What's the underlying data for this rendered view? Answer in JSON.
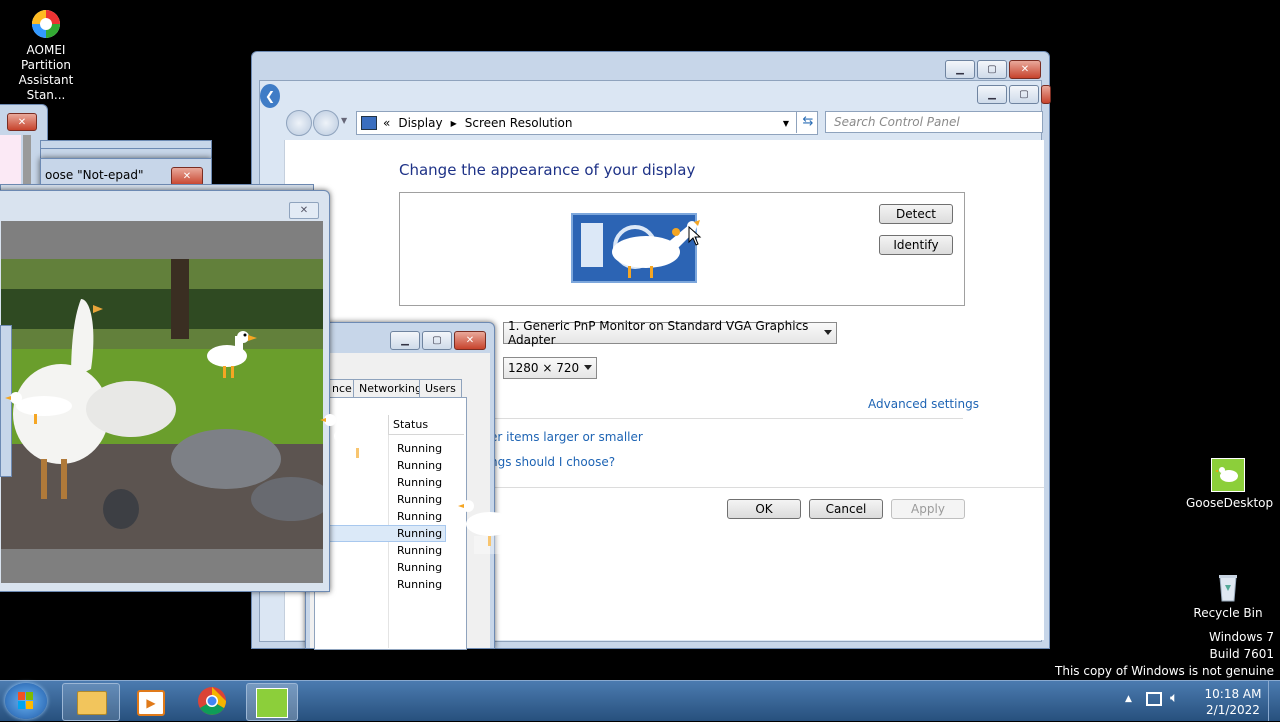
{
  "desktop": {
    "icons": [
      {
        "label_line1": "AOMEI Partition",
        "label_line2": "Assistant Stan..."
      },
      {
        "label": "GooseDesktop"
      },
      {
        "label": "Recycle Bin"
      }
    ],
    "watermark": {
      "line1": "Windows 7",
      "line2": "Build 7601",
      "line3": "This copy of Windows is not genuine"
    }
  },
  "control_panel": {
    "breadcrumb": {
      "prefix": "«",
      "item1": "Display",
      "item2": "Screen Resolution"
    },
    "search_placeholder": "Search Control Panel",
    "heading": "Change the appearance of your display",
    "detect_label": "Detect",
    "identify_label": "Identify",
    "display_select": "1. Generic PnP Monitor on Standard VGA Graphics Adapter",
    "resolution_select": "1280 × 720",
    "advanced_settings": "Advanced settings",
    "link_larger": "er items larger or smaller",
    "link_choose": "ngs should I choose?",
    "ok_label": "OK",
    "cancel_label": "Cancel",
    "apply_label": "Apply"
  },
  "notepad_chooser": {
    "title": "oose \"Not-epad\""
  },
  "task_manager": {
    "tabs": [
      "nce",
      "Networking",
      "Users"
    ],
    "status_header": "Status",
    "status_rows": [
      "Running",
      "Running",
      "Running",
      "Running",
      "Running",
      "Running",
      "Running",
      "Running",
      "Running"
    ]
  },
  "taskbar": {
    "clock_time": "10:18 AM",
    "clock_date": "2/1/2022"
  },
  "colors": {
    "accent_link": "#1e64b4",
    "taskbar": "#2e5b8a",
    "heading": "#1e3287"
  }
}
